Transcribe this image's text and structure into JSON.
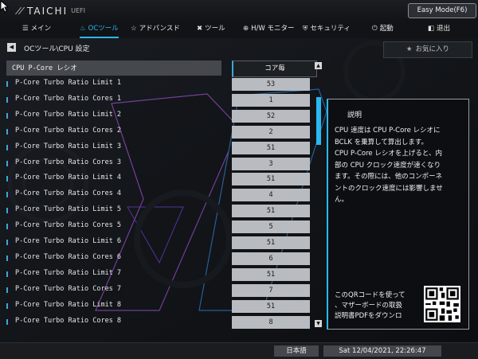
{
  "brand": {
    "logo": "TAICHI",
    "suffix": "UEFI"
  },
  "mode_button": "Easy Mode(F6)",
  "nav": [
    {
      "icon": "home-icon",
      "glyph": "☰",
      "label": "メイン",
      "active": false
    },
    {
      "icon": "oc-flame-icon",
      "glyph": "♨",
      "label": "OCツール",
      "active": true
    },
    {
      "icon": "star-icon",
      "glyph": "☆",
      "label": "アドバンスド",
      "active": false
    },
    {
      "icon": "tools-icon",
      "glyph": "✖",
      "label": "ツール",
      "active": false
    },
    {
      "icon": "monitor-icon",
      "glyph": "⊕",
      "label": "H/W モニター",
      "active": false
    },
    {
      "icon": "shield-icon",
      "glyph": "⛨",
      "label": "セキュリティ",
      "active": false
    },
    {
      "icon": "power-icon",
      "glyph": "⏻",
      "label": "起動",
      "active": false
    },
    {
      "icon": "exit-icon",
      "glyph": "◧",
      "label": "退出",
      "active": false
    }
  ],
  "breadcrumb": "OCツール\\CPU 設定",
  "favorite_button": "お気に入り",
  "settings": {
    "header": {
      "label": "CPU P-Core レシオ",
      "value": "コア毎"
    },
    "rows": [
      {
        "label": "P-Core Turbo Ratio Limit 1",
        "value": "53"
      },
      {
        "label": "P-Core Turbo Ratio Cores 1",
        "value": "1"
      },
      {
        "label": "P-Core Turbo Ratio Limit 2",
        "value": "52"
      },
      {
        "label": "P-Core Turbo Ratio Cores 2",
        "value": "2"
      },
      {
        "label": "P-Core Turbo Ratio Limit 3",
        "value": "51"
      },
      {
        "label": "P-Core Turbo Ratio Cores 3",
        "value": "3"
      },
      {
        "label": "P-Core Turbo Ratio Limit 4",
        "value": "51"
      },
      {
        "label": "P-Core Turbo Ratio Cores 4",
        "value": "4"
      },
      {
        "label": "P-Core Turbo Ratio Limit 5",
        "value": "51"
      },
      {
        "label": "P-Core Turbo Ratio Cores 5",
        "value": "5"
      },
      {
        "label": "P-Core Turbo Ratio Limit 6",
        "value": "51"
      },
      {
        "label": "P-Core Turbo Ratio Cores 6",
        "value": "6"
      },
      {
        "label": "P-Core Turbo Ratio Limit 7",
        "value": "51"
      },
      {
        "label": "P-Core Turbo Ratio Cores 7",
        "value": "7"
      },
      {
        "label": "P-Core Turbo Ratio Limit 8",
        "value": "51"
      },
      {
        "label": "P-Core Turbo Ratio Cores 8",
        "value": "8"
      }
    ]
  },
  "description": {
    "title": "説明",
    "text": "CPU 速度は CPU P-Core レシオに\nBCLK を乗算して算出します。\nCPU P-Core レシオを上げると、内\n部の CPU クロック速度が速くなり\nます。その際には、他のコンポーネ\nントのクロック速度には影響しませ\nん。",
    "qr_text": "このQRコードを使って\n、マザーボードの取扱\n説明書PDFをダウンロ"
  },
  "language": "日本語",
  "datetime": "Sat 12/04/2021, 22:26:47",
  "colors": {
    "accent": "#2ab8f2",
    "value_bg": "#b8bbbf",
    "neon": "#c060ff"
  }
}
